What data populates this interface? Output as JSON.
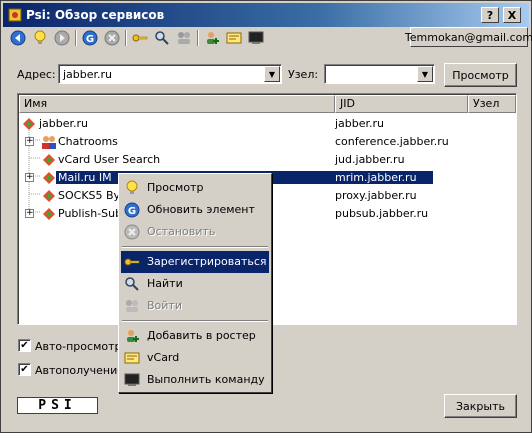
{
  "window": {
    "title": "Psi: Обзор сервисов",
    "help_label": "?",
    "close_label": "X"
  },
  "toolbar": {
    "icons": [
      "back-icon",
      "bulb-icon",
      "forward-icon",
      "refresh-icon",
      "stop-icon",
      "key-icon",
      "search-icon",
      "users-icon",
      "add-contact-icon",
      "vcard-icon",
      "terminal-icon"
    ],
    "account": "Temmokan@gmail.com"
  },
  "address": {
    "label": "Адрес:",
    "value": "jabber.ru",
    "node_label": "Узел:",
    "node_value": "",
    "browse_label": "Просмотр"
  },
  "tree": {
    "columns": [
      "Имя",
      "JID",
      "Узел"
    ],
    "rows": [
      {
        "name": "jabber.ru",
        "jid": "jabber.ru",
        "expander": ""
      },
      {
        "name": "Chatrooms",
        "jid": "conference.jabber.ru",
        "expander": "+"
      },
      {
        "name": "vCard User Search",
        "jid": "jud.jabber.ru",
        "expander": ""
      },
      {
        "name": "Mail.ru IM",
        "jid": "mrim.jabber.ru",
        "expander": "+"
      },
      {
        "name": "SOCKS5 Byte",
        "jid": "proxy.jabber.ru",
        "expander": ""
      },
      {
        "name": "Publish-Subsc",
        "jid": "pubsub.jabber.ru",
        "expander": "+"
      }
    ]
  },
  "context_menu": {
    "items": [
      {
        "label": "Просмотр",
        "icon": "bulb-icon",
        "disabled": false
      },
      {
        "label": "Обновить элемент",
        "icon": "refresh-icon",
        "disabled": false
      },
      {
        "label": "Остановить",
        "icon": "stop-icon",
        "disabled": true
      },
      {
        "label": "Зарегистрироваться",
        "icon": "key-icon",
        "disabled": false,
        "active": true
      },
      {
        "label": "Найти",
        "icon": "search-icon",
        "disabled": false
      },
      {
        "label": "Войти",
        "icon": "users-icon",
        "disabled": true
      },
      {
        "label": "Добавить в ростер",
        "icon": "add-contact-icon",
        "disabled": false
      },
      {
        "label": "vCard",
        "icon": "vcard-icon",
        "disabled": false
      },
      {
        "label": "Выполнить команду",
        "icon": "terminal-icon",
        "disabled": false
      }
    ]
  },
  "options": {
    "auto_browse": "Авто-просмотр з",
    "auto_fetch": "Автополучение н"
  },
  "footer": {
    "logo": "PSI",
    "close_label": "Закрыть"
  },
  "colors": {
    "selection": "#0a246a",
    "face": "#d4d0c8"
  }
}
